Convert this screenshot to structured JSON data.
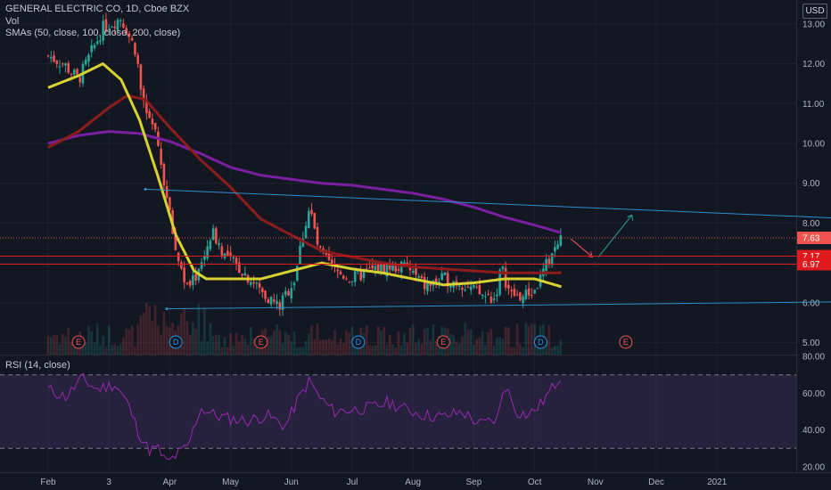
{
  "header": {
    "title": "GENERAL ELECTRIC CO, 1D, Cboe BZX",
    "vol": "Vol",
    "smas": "SMAs (50, close, 100, close, 200, close)",
    "rsi": "RSI (14, close)",
    "currency": "USD"
  },
  "chart_data": {
    "type": "candlestick",
    "price_axis": {
      "ticks": [
        "13.00",
        "12.00",
        "11.00",
        "10.00",
        "9.00",
        "8.00",
        "7.00",
        "6.00",
        "5.00"
      ],
      "range": [
        4.7,
        13.6
      ]
    },
    "rsi_axis": {
      "ticks": [
        "80.00",
        "60.00",
        "40.00",
        "20.00"
      ],
      "range": [
        17,
        81
      ],
      "band": [
        30,
        70
      ]
    },
    "time_axis": [
      "Feb",
      "3",
      "Apr",
      "May",
      "Jun",
      "Jul",
      "Aug",
      "Sep",
      "Oct",
      "Nov",
      "Dec",
      "2021"
    ],
    "price_tags": [
      {
        "label": "7.63",
        "value": 7.63,
        "color": "#ef5350",
        "style": "dotted"
      },
      {
        "label": "7.17",
        "value": 7.17,
        "color": "#e0191c",
        "style": "solid"
      },
      {
        "label": "6.97",
        "value": 6.97,
        "color": "#e0191c",
        "style": "solid"
      }
    ],
    "events": [
      {
        "label": "E",
        "month_index": 0.5,
        "type": "earnings"
      },
      {
        "label": "D",
        "month_index": 2.1,
        "type": "dividend"
      },
      {
        "label": "E",
        "month_index": 3.5,
        "type": "earnings"
      },
      {
        "label": "D",
        "month_index": 5.1,
        "type": "dividend"
      },
      {
        "label": "E",
        "month_index": 6.5,
        "type": "earnings"
      },
      {
        "label": "D",
        "month_index": 8.1,
        "type": "dividend"
      },
      {
        "label": "E",
        "month_index": 9.5,
        "type": "earnings"
      }
    ],
    "trendlines": [
      {
        "name": "upper",
        "from": [
          1.6,
          8.85
        ],
        "to": [
          13.4,
          8.1
        ]
      },
      {
        "name": "lower",
        "from": [
          1.95,
          5.85
        ],
        "to": [
          13.4,
          6.03
        ]
      }
    ],
    "candle_anchors": [
      [
        0.0,
        12.2
      ],
      [
        0.25,
        12.0
      ],
      [
        0.5,
        11.6
      ],
      [
        0.9,
        12.9
      ],
      [
        1.2,
        13.15
      ],
      [
        1.45,
        12.3
      ],
      [
        1.55,
        11.0
      ],
      [
        1.75,
        10.3
      ],
      [
        1.85,
        9.6
      ],
      [
        1.93,
        8.8
      ],
      [
        2.1,
        7.3
      ],
      [
        2.3,
        6.3
      ],
      [
        2.5,
        6.9
      ],
      [
        2.7,
        7.8
      ],
      [
        2.9,
        7.2
      ],
      [
        3.2,
        6.8
      ],
      [
        3.5,
        6.3
      ],
      [
        3.8,
        5.9
      ],
      [
        4.05,
        6.6
      ],
      [
        4.2,
        7.8
      ],
      [
        4.3,
        8.4
      ],
      [
        4.45,
        7.3
      ],
      [
        4.7,
        6.8
      ],
      [
        5.0,
        6.6
      ],
      [
        5.3,
        6.8
      ],
      [
        5.6,
        6.9
      ],
      [
        5.9,
        6.9
      ],
      [
        6.2,
        6.4
      ],
      [
        6.5,
        6.6
      ],
      [
        6.8,
        6.5
      ],
      [
        7.1,
        6.2
      ],
      [
        7.35,
        6.1
      ],
      [
        7.45,
        6.9
      ],
      [
        7.6,
        6.2
      ],
      [
        7.8,
        6.15
      ],
      [
        8.0,
        6.3
      ],
      [
        8.15,
        6.8
      ],
      [
        8.3,
        7.3
      ],
      [
        8.45,
        7.63
      ]
    ],
    "sma50": [
      [
        0.0,
        11.4
      ],
      [
        0.5,
        11.7
      ],
      [
        0.9,
        12.0
      ],
      [
        1.2,
        11.6
      ],
      [
        1.5,
        10.6
      ],
      [
        1.8,
        9.2
      ],
      [
        2.1,
        7.7
      ],
      [
        2.4,
        6.8
      ],
      [
        2.6,
        6.6
      ],
      [
        3.0,
        6.6
      ],
      [
        3.5,
        6.6
      ],
      [
        4.0,
        6.8
      ],
      [
        4.5,
        7.0
      ],
      [
        5.0,
        6.85
      ],
      [
        5.5,
        6.75
      ],
      [
        6.0,
        6.6
      ],
      [
        6.5,
        6.45
      ],
      [
        7.0,
        6.5
      ],
      [
        7.5,
        6.6
      ],
      [
        8.0,
        6.6
      ],
      [
        8.45,
        6.4
      ]
    ],
    "sma100": [
      [
        0.0,
        9.9
      ],
      [
        0.5,
        10.3
      ],
      [
        1.0,
        10.9
      ],
      [
        1.3,
        11.2
      ],
      [
        1.6,
        11.1
      ],
      [
        2.0,
        10.4
      ],
      [
        2.5,
        9.6
      ],
      [
        3.0,
        8.9
      ],
      [
        3.5,
        8.1
      ],
      [
        4.0,
        7.7
      ],
      [
        4.5,
        7.3
      ],
      [
        5.0,
        7.15
      ],
      [
        5.5,
        7.0
      ],
      [
        6.0,
        6.9
      ],
      [
        6.5,
        6.85
      ],
      [
        7.0,
        6.8
      ],
      [
        7.5,
        6.75
      ],
      [
        8.0,
        6.75
      ],
      [
        8.45,
        6.75
      ]
    ],
    "sma200": [
      [
        0.0,
        10.0
      ],
      [
        0.5,
        10.2
      ],
      [
        1.0,
        10.3
      ],
      [
        1.5,
        10.25
      ],
      [
        2.0,
        10.05
      ],
      [
        2.5,
        9.75
      ],
      [
        3.0,
        9.4
      ],
      [
        3.5,
        9.2
      ],
      [
        4.0,
        9.1
      ],
      [
        4.5,
        9.0
      ],
      [
        5.0,
        8.95
      ],
      [
        5.5,
        8.85
      ],
      [
        6.0,
        8.75
      ],
      [
        6.5,
        8.6
      ],
      [
        7.0,
        8.4
      ],
      [
        7.5,
        8.15
      ],
      [
        8.0,
        7.95
      ],
      [
        8.45,
        7.75
      ]
    ],
    "rsi_anchors": [
      [
        0.0,
        62
      ],
      [
        0.3,
        58
      ],
      [
        0.55,
        68
      ],
      [
        0.8,
        62
      ],
      [
        1.1,
        65
      ],
      [
        1.3,
        55
      ],
      [
        1.5,
        38
      ],
      [
        1.65,
        29
      ],
      [
        1.8,
        30
      ],
      [
        1.95,
        22
      ],
      [
        2.1,
        26
      ],
      [
        2.3,
        31
      ],
      [
        2.5,
        52
      ],
      [
        2.75,
        48
      ],
      [
        3.0,
        46
      ],
      [
        3.3,
        45
      ],
      [
        3.6,
        48
      ],
      [
        3.9,
        42
      ],
      [
        4.1,
        56
      ],
      [
        4.3,
        67
      ],
      [
        4.45,
        58
      ],
      [
        4.7,
        50
      ],
      [
        5.0,
        51
      ],
      [
        5.3,
        52
      ],
      [
        5.6,
        55
      ],
      [
        5.9,
        51
      ],
      [
        6.2,
        48
      ],
      [
        6.5,
        47
      ],
      [
        6.8,
        50
      ],
      [
        7.1,
        43
      ],
      [
        7.4,
        46
      ],
      [
        7.5,
        66
      ],
      [
        7.7,
        50
      ],
      [
        7.9,
        48
      ],
      [
        8.1,
        54
      ],
      [
        8.3,
        63
      ],
      [
        8.45,
        71
      ]
    ]
  }
}
